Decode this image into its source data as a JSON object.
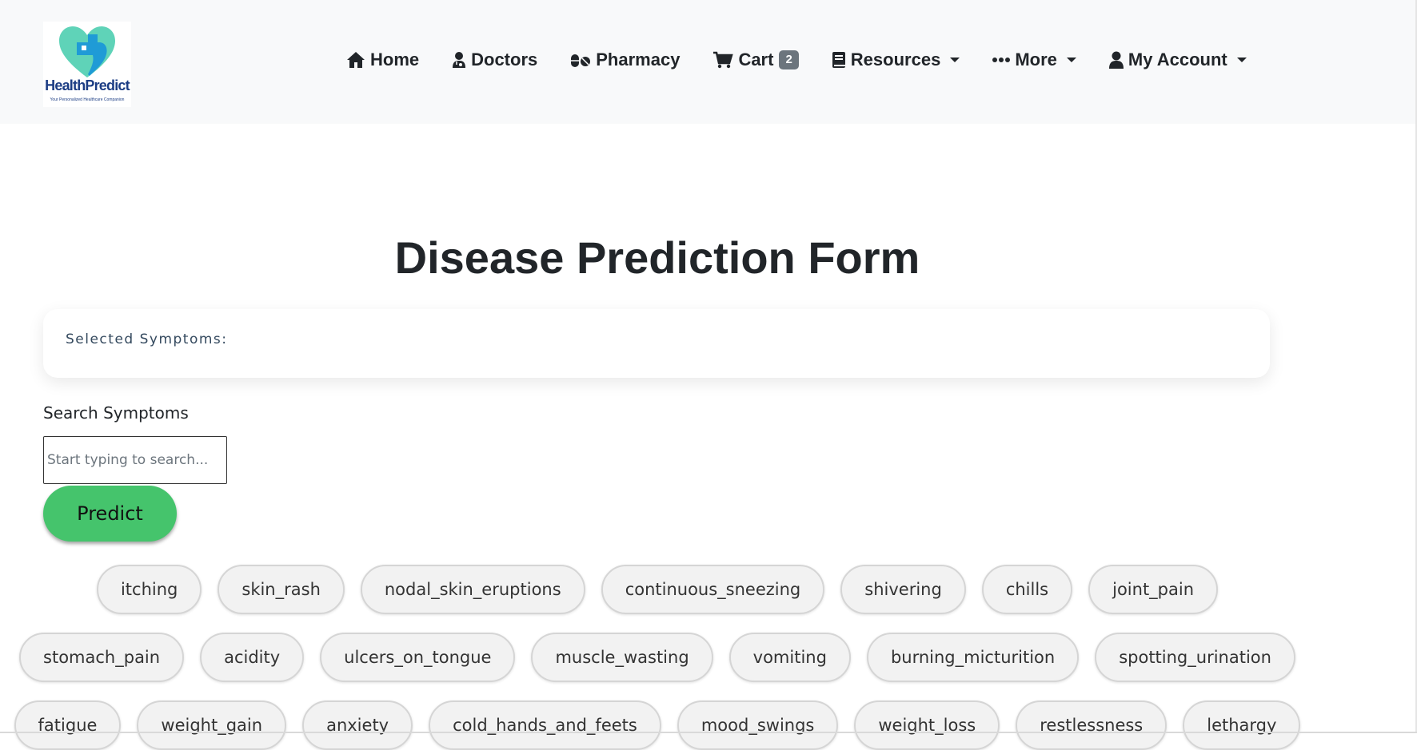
{
  "brand": {
    "name": "HealthPredict",
    "tagline": "Your Personalized Healthcare Companion",
    "colors": {
      "heart_teal": "#5fd3b8",
      "heart_blue": "#1f9bd6",
      "text": "#1c3d84"
    }
  },
  "nav": {
    "items": [
      {
        "label": "Home",
        "icon": "home-icon"
      },
      {
        "label": "Doctors",
        "icon": "doctor-icon"
      },
      {
        "label": "Pharmacy",
        "icon": "pills-icon"
      },
      {
        "label": "Cart",
        "icon": "cart-icon",
        "badge": "2"
      },
      {
        "label": "Resources",
        "icon": "book-icon",
        "dropdown": true
      },
      {
        "label": "More",
        "icon": "ellipsis-icon",
        "dropdown": true
      },
      {
        "label": "My Account",
        "icon": "user-icon",
        "dropdown": true
      }
    ]
  },
  "page": {
    "title": "Disease Prediction Form",
    "selected_label": "Selected Symptoms:",
    "search_label": "Search Symptoms",
    "search_placeholder": "Start typing to search...",
    "predict_label": "Predict"
  },
  "symptoms": {
    "row1": [
      "itching",
      "skin_rash",
      "nodal_skin_eruptions",
      "continuous_sneezing",
      "shivering",
      "chills",
      "joint_pain"
    ],
    "row2": [
      "stomach_pain",
      "acidity",
      "ulcers_on_tongue",
      "muscle_wasting",
      "vomiting",
      "burning_micturition",
      "spotting_urination"
    ],
    "row3": [
      "fatigue",
      "weight_gain",
      "anxiety",
      "cold_hands_and_feets",
      "mood_swings",
      "weight_loss",
      "restlessness",
      "lethargy"
    ]
  },
  "colors": {
    "predict_button": "#45c46c",
    "navbar_bg": "#f8f9fa",
    "badge_bg": "#6c757d"
  }
}
